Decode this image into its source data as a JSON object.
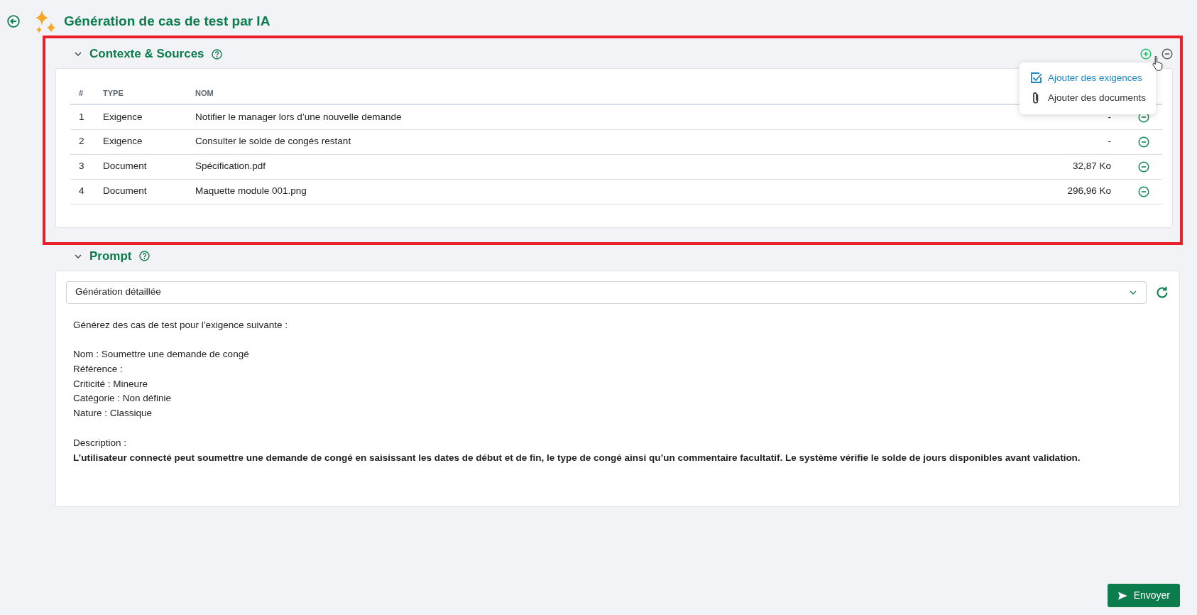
{
  "page": {
    "title": "Génération de cas de test par IA"
  },
  "context": {
    "title": "Contexte & Sources",
    "expanded": true,
    "highlighted": true,
    "columns": [
      "#",
      "TYPE",
      "NOM"
    ],
    "rows": [
      {
        "number": "1",
        "type": "Exigence",
        "name": "Notifier le manager lors d’une nouvelle demande",
        "size": "-"
      },
      {
        "number": "2",
        "type": "Exigence",
        "name": "Consulter le solde de congés restant",
        "size": "-"
      },
      {
        "number": "3",
        "type": "Document",
        "name": "Spécification.pdf",
        "size": "32,87 Ko"
      },
      {
        "number": "4",
        "type": "Document",
        "name": "Maquette module 001.png",
        "size": "296,96 Ko"
      }
    ],
    "add_menu": [
      {
        "kind": "requirement",
        "label": "Ajouter des exigences",
        "selected": true
      },
      {
        "kind": "document",
        "label": "Ajouter des documents",
        "selected": false
      }
    ]
  },
  "prompt": {
    "title": "Prompt",
    "expanded": true,
    "template": "Génération détaillée",
    "intro": "Générez des cas de test pour l'exigence suivante :",
    "fields": [
      "Nom : Soumettre une demande de congé",
      "Référence :",
      "Criticité : Mineure",
      "Catégorie : Non définie",
      "Nature : Classique"
    ],
    "description_label": "Description :",
    "description": "L’utilisateur connecté peut soumettre une demande de congé en saisissant les dates de début et de fin, le type de congé ainsi qu’un commentaire facultatif. Le système vérifie le solde de jours disponibles avant validation."
  },
  "send_button": "Envoyer"
}
